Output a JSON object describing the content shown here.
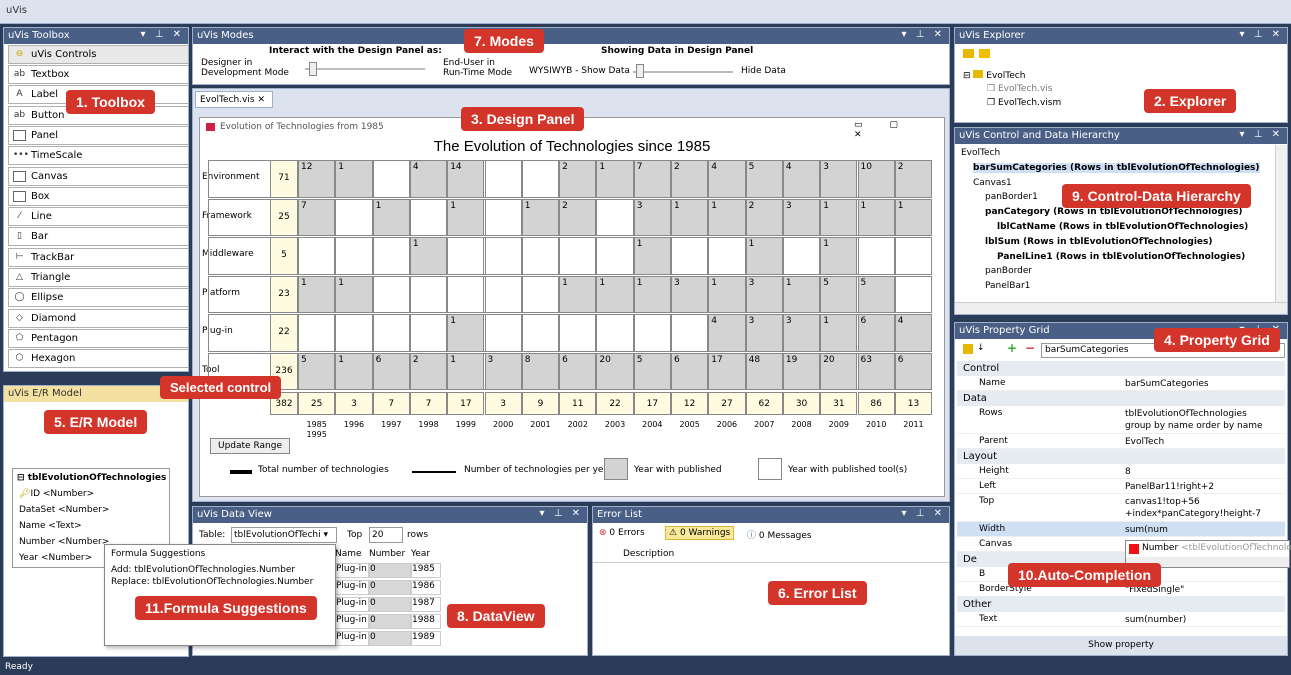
{
  "app": {
    "title": "uVis",
    "status": "Ready"
  },
  "toolbox": {
    "title": "uVis Toolbox",
    "group": "uVis Controls",
    "items": [
      "Textbox",
      "Label",
      "Button",
      "Panel",
      "TimeScale",
      "Canvas",
      "Box",
      "Line",
      "Bar",
      "TrackBar",
      "Triangle",
      "Ellipse",
      "Diamond",
      "Pentagon",
      "Hexagon"
    ],
    "icons": [
      "ab",
      "A",
      "ab",
      "",
      "•••",
      "",
      "",
      "⁄",
      "▯",
      "⊢",
      "△",
      "◯",
      "◇",
      "⬠",
      "⬡"
    ]
  },
  "modes": {
    "title": "uVis Modes",
    "interact": "Interact with the Design Panel as:",
    "designer": "Designer in\nDevelopment Mode",
    "enduser": "End-User in\nRun-Time Mode",
    "showing": "Showing Data in Design Panel",
    "wysiwyb": "WYSIWYB - Show Data",
    "hide": "Hide Data"
  },
  "design": {
    "tab": "EvolTech.vis",
    "window_title": "Evolution of Technologies from 1985",
    "heading": "The Evolution of Technologies since 1985",
    "categories": [
      "Environment",
      "Framework",
      "Middleware",
      "Platform",
      "Plug-in",
      "Tool"
    ],
    "cat_totals": [
      "71",
      "25",
      "5",
      "23",
      "22",
      "236"
    ],
    "grand_total": "382",
    "year_totals": [
      "25",
      "3",
      "7",
      "7",
      "17",
      "3",
      "9",
      "11",
      "22",
      "17",
      "12",
      "27",
      "62",
      "30",
      "31",
      "86",
      "13"
    ],
    "years": [
      "1985\n1995",
      "1996",
      "1997",
      "1998",
      "1999",
      "2000",
      "2001",
      "2002",
      "2003",
      "2004",
      "2005",
      "2006",
      "2007",
      "2008",
      "2009",
      "2010",
      "2011"
    ],
    "cells": [
      [
        "12",
        "1",
        "",
        "4",
        "14",
        "",
        "",
        "2",
        "1",
        "7",
        "2",
        "4",
        "5",
        "4",
        "3",
        "10",
        "2"
      ],
      [
        "7",
        "",
        "1",
        "",
        "1",
        "",
        "1",
        "2",
        "",
        "3",
        "1",
        "1",
        "2",
        "3",
        "1",
        "1",
        "1"
      ],
      [
        "",
        "",
        "",
        "1",
        "",
        "",
        "",
        "",
        "",
        "1",
        "",
        "",
        "1",
        "",
        "1",
        "",
        ""
      ],
      [
        "1",
        "1",
        "",
        "",
        "",
        "",
        "",
        "1",
        "1",
        "1",
        "3",
        "1",
        "3",
        "1",
        "5",
        "5",
        ""
      ],
      [
        "",
        "",
        "",
        "",
        "1",
        "",
        "",
        "",
        "",
        "",
        "",
        "4",
        "3",
        "3",
        "1",
        "6",
        "4"
      ],
      [
        "5",
        "1",
        "6",
        "2",
        "1",
        "3",
        "8",
        "6",
        "20",
        "5",
        "6",
        "17",
        "48",
        "19",
        "20",
        "63",
        "6"
      ]
    ],
    "update_btn": "Update Range",
    "legend": [
      "Total number of technologies",
      "Number of technologies per year",
      "Year with published",
      "Year with published tool(s)"
    ]
  },
  "explorer": {
    "title": "uVis Explorer",
    "root": "EvolTech",
    "files": [
      "EvolTech.vis",
      "EvolTech.vism"
    ]
  },
  "hierarchy": {
    "title": "uVis Control and Data Hierarchy",
    "items": [
      {
        "t": "EvolTech",
        "d": 0,
        "b": false
      },
      {
        "t": "barSumCategories (Rows in tblEvolutionOfTechnologies)",
        "d": 1,
        "b": true
      },
      {
        "t": "Canvas1",
        "d": 1,
        "b": false
      },
      {
        "t": "panBorder1",
        "d": 2,
        "b": false
      },
      {
        "t": "panCategory (Rows in tblEvolutionOfTechnologies)",
        "d": 2,
        "b": true
      },
      {
        "t": "lblCatName (Rows in tblEvolutionOfTechnologies)",
        "d": 3,
        "b": true
      },
      {
        "t": "lblSum (Rows in tblEvolutionOfTechnologies)",
        "d": 2,
        "b": true
      },
      {
        "t": "PanelLine1 (Rows in tblEvolutionOfTechnologies)",
        "d": 3,
        "b": true
      },
      {
        "t": "panBorder",
        "d": 2,
        "b": false
      },
      {
        "t": "PanelBar1",
        "d": 2,
        "b": false
      }
    ]
  },
  "propgrid": {
    "title": "uVis  Property Grid",
    "selected": "barSumCategories",
    "show": "Show property",
    "rows": [
      {
        "c": "Control"
      },
      {
        "k": "Name",
        "v": "barSumCategories"
      },
      {
        "c": "Data"
      },
      {
        "k": "Rows",
        "v": "tblEvolutionOfTechnologies\ngroup by name order by name"
      },
      {
        "k": "Parent",
        "v": "EvolTech"
      },
      {
        "c": "Layout"
      },
      {
        "k": "Height",
        "v": "8"
      },
      {
        "k": "Left",
        "v": "PanelBar11!right+2"
      },
      {
        "k": "Top",
        "v": "canvas1!top+56\n+index*panCategory!height-7"
      },
      {
        "k": "Width",
        "v": "sum(num"
      },
      {
        "k": "Canvas",
        "v": "Number <tblEvolutionOfTechnolo"
      },
      {
        "c": "De"
      },
      {
        "k": "B",
        "v": "ack\""
      },
      {
        "k": "BorderStyle",
        "v": "\"FixedSingle\""
      },
      {
        "c": "Other"
      },
      {
        "k": "Text",
        "v": "sum(number)"
      }
    ]
  },
  "er": {
    "title": "uVis E/R Model",
    "table": "tblEvolutionOfTechnologies",
    "fields": [
      "ID <Number>",
      "DataSet <Number>",
      "Name <Text>",
      "Number <Number>",
      "Year <Number>"
    ]
  },
  "suggest": {
    "title": "Formula Suggestions",
    "add": "Add: tblEvolutionOfTechnologies.Number",
    "replace": "Replace: tblEvolutionOfTechnologies.Number"
  },
  "dataview": {
    "title": "uVis Data View",
    "table_label": "Table:",
    "table": "tblEvolutionOfTechi",
    "top_label": "Top",
    "top": "20",
    "rows_label": "rows",
    "cols": [
      "Name",
      "Number",
      "Year"
    ],
    "rows": [
      [
        "Plug-in",
        "0",
        "1985"
      ],
      [
        "Plug-in",
        "0",
        "1986"
      ],
      [
        "Plug-in",
        "0",
        "1987"
      ],
      [
        "Plug-in",
        "0",
        "1988"
      ],
      [
        "Plug-in",
        "0",
        "1989"
      ]
    ]
  },
  "errors": {
    "title": "Error List",
    "errors": "0 Errors",
    "warnings": "0 Warnings",
    "messages": "0 Messages",
    "col": "Description"
  },
  "callouts": [
    "1. Toolbox",
    "2. Explorer",
    "3. Design Panel",
    "4. Property Grid",
    "5. E/R Model",
    "6. Error List",
    "7. Modes",
    "8. DataView",
    "9. Control-Data Hierarchy",
    "10.Auto-Completion",
    "11.Formula Suggestions",
    "Selected control"
  ]
}
